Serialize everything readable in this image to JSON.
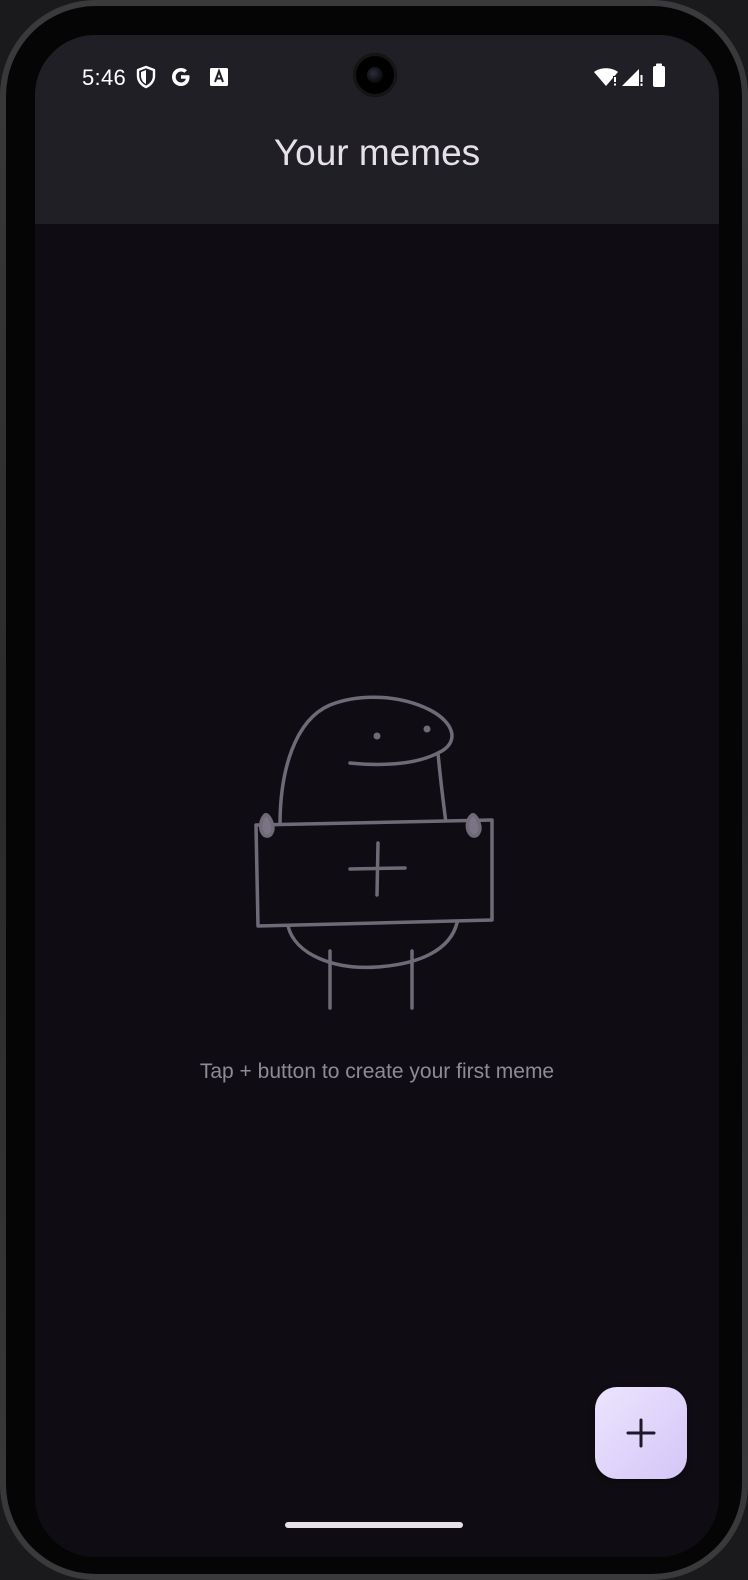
{
  "status_bar": {
    "time": "5:46",
    "icons": [
      "shield-icon",
      "google-icon",
      "translate-icon",
      "wifi-icon",
      "signal-icon",
      "battery-icon"
    ]
  },
  "app_bar": {
    "title": "Your memes"
  },
  "empty_state": {
    "illustration": "character-holding-plus-sign-illustration",
    "message": "Tap + button to create your first meme"
  },
  "fab": {
    "icon": "plus-icon"
  },
  "colors": {
    "background": "#0f0d13",
    "app_bar": "#211f26",
    "title_text": "#e6e0e9",
    "secondary_text": "#8f8a96",
    "illustration_stroke": "#6e6a78",
    "fab_start": "#ece4fd",
    "fab_end": "#d4c6f8"
  }
}
